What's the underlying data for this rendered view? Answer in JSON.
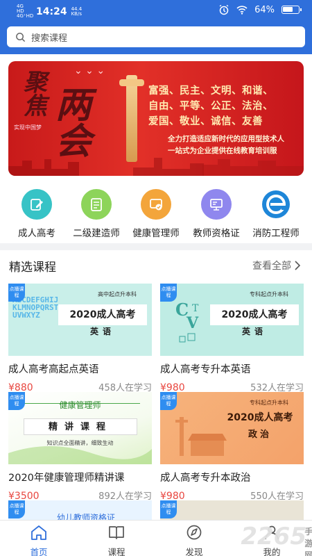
{
  "status_bar": {
    "network": "4G HD 4G⁺HD",
    "time": "14:24",
    "speed": "44.4 KB/s",
    "battery": "64%"
  },
  "search": {
    "placeholder": "搜索课程"
  },
  "banner": {
    "calligraphy_1": "聚焦",
    "calligraphy_2": "两会",
    "subtitle": "实现中国梦",
    "values_line_1": "富强、民主、文明、和谐、",
    "values_line_2": "自由、平等、公正、法治、",
    "values_line_3": "爱国、敬业、诚信、友善",
    "slogan_1": "全力打造适应新时代的应用型技术人",
    "slogan_2": "一站式为企业提供在线教育培训服"
  },
  "categories": [
    {
      "label": "成人高考",
      "color": "#37c3c6",
      "icon": "pencil-note-icon"
    },
    {
      "label": "二级建造师",
      "color": "#8dd45a",
      "icon": "document-list-icon"
    },
    {
      "label": "健康管理师",
      "color": "#f3a53b",
      "icon": "certificate-check-icon"
    },
    {
      "label": "教师资格证",
      "color": "#8f87ee",
      "icon": "presentation-board-icon"
    },
    {
      "label": "消防工程师",
      "color": "#1e86d8",
      "icon": "brand-e-logo-icon"
    }
  ],
  "section": {
    "title": "精选课程",
    "more": "查看全部"
  },
  "courses": [
    {
      "title": "成人高考高起点英语",
      "price": "¥880",
      "learners": "458人在学习",
      "tag": "点播课程",
      "thumb_level": "高中起点升本科",
      "thumb_title": "2020成人高考",
      "thumb_subject": "英语",
      "thumb_deco": "ABCDEFGHIJKLMNOPQRSTUVWXYZ"
    },
    {
      "title": "成人高考专升本英语",
      "price": "¥980",
      "learners": "532人在学习",
      "tag": "点播课程",
      "thumb_level": "专科起点升本科",
      "thumb_title": "2020成人高考",
      "thumb_subject": "英语"
    },
    {
      "title": "2020年健康管理师精讲课",
      "price": "¥3500",
      "learners": "892人在学习",
      "tag": "点播课程",
      "thumb_title": "健康管理师",
      "thumb_subject": "精讲课程",
      "thumb_note": "知识点全面精讲，细致生动"
    },
    {
      "title": "成人高考专升本政治",
      "price": "¥980",
      "learners": "550人在学习",
      "tag": "点播课程",
      "thumb_level": "专科起点升本科",
      "thumb_title": "2020成人高考",
      "thumb_subject": "政治"
    },
    {
      "tag": "点播课程",
      "thumb_title": "幼儿教师资格证"
    },
    {
      "tag": "点播课程"
    }
  ],
  "bottom_nav": [
    {
      "label": "首页",
      "icon": "home-icon",
      "active": true
    },
    {
      "label": "课程",
      "icon": "book-icon",
      "active": false
    },
    {
      "label": "发现",
      "icon": "compass-icon",
      "active": false
    },
    {
      "label": "我的",
      "icon": "user-icon",
      "active": false
    }
  ],
  "watermark": {
    "number": "2265",
    "text": "手游网"
  },
  "colors": {
    "header_blue": "#2f6fdb",
    "price_red": "#e8463f",
    "nav_active": "#2f6fdb",
    "tag_blue": "#2f8df0"
  }
}
